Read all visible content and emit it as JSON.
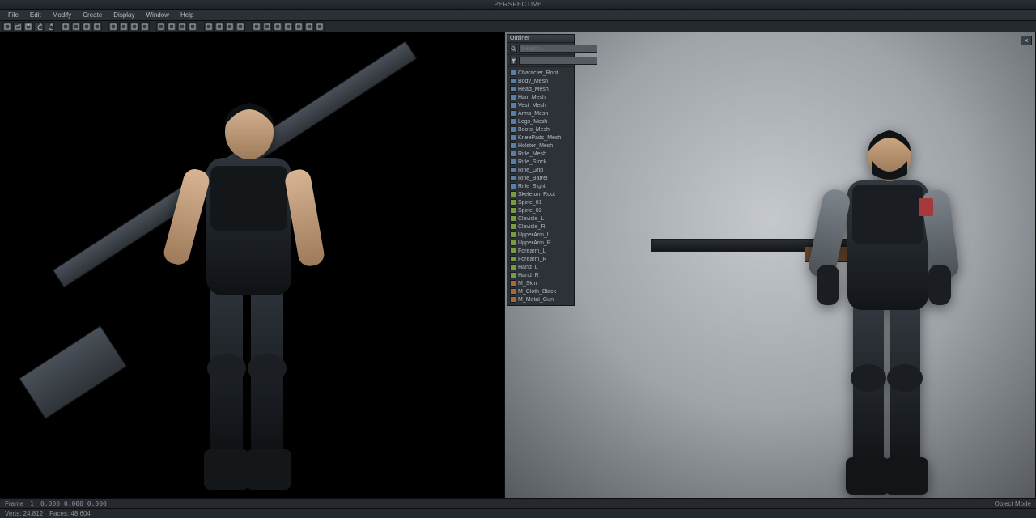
{
  "titlebar": {
    "left": "",
    "center": "PERSPECTIVE",
    "right": ""
  },
  "menubar": {
    "items": [
      "File",
      "Edit",
      "Modify",
      "Create",
      "Display",
      "Window",
      "Help"
    ]
  },
  "shelf": {
    "tools": [
      "new-icon",
      "open-icon",
      "save-icon",
      "undo-icon",
      "redo-icon",
      "select-icon",
      "move-icon",
      "rotate-icon",
      "scale-icon",
      "mesh-icon",
      "surface-icon",
      "curve-icon",
      "lattice-icon",
      "joint-icon",
      "ik-icon",
      "skin-icon",
      "paint-icon",
      "render-icon",
      "light-icon",
      "camera-icon",
      "grid-icon",
      "snap-icon",
      "wire-icon",
      "shade-icon",
      "smooth-icon",
      "uv-icon",
      "tex-icon",
      "graph-icon"
    ]
  },
  "panel": {
    "title": "Outliner",
    "search_placeholder": "Search...",
    "search_value": "",
    "items": [
      {
        "type": "mesh",
        "label": "Character_Root"
      },
      {
        "type": "mesh",
        "label": "Body_Mesh"
      },
      {
        "type": "mesh",
        "label": "Head_Mesh"
      },
      {
        "type": "mesh",
        "label": "Hair_Mesh"
      },
      {
        "type": "mesh",
        "label": "Vest_Mesh"
      },
      {
        "type": "mesh",
        "label": "Arms_Mesh"
      },
      {
        "type": "mesh",
        "label": "Legs_Mesh"
      },
      {
        "type": "mesh",
        "label": "Boots_Mesh"
      },
      {
        "type": "mesh",
        "label": "KneePads_Mesh"
      },
      {
        "type": "mesh",
        "label": "Holster_Mesh"
      },
      {
        "type": "mesh",
        "label": "Rifle_Mesh"
      },
      {
        "type": "mesh",
        "label": "Rifle_Stock"
      },
      {
        "type": "mesh",
        "label": "Rifle_Grip"
      },
      {
        "type": "mesh",
        "label": "Rifle_Barrel"
      },
      {
        "type": "mesh",
        "label": "Rifle_Sight"
      },
      {
        "type": "bone",
        "label": "Skeleton_Root"
      },
      {
        "type": "bone",
        "label": "Spine_01"
      },
      {
        "type": "bone",
        "label": "Spine_02"
      },
      {
        "type": "bone",
        "label": "Clavicle_L"
      },
      {
        "type": "bone",
        "label": "Clavicle_R"
      },
      {
        "type": "bone",
        "label": "UpperArm_L"
      },
      {
        "type": "bone",
        "label": "UpperArm_R"
      },
      {
        "type": "bone",
        "label": "Forearm_L"
      },
      {
        "type": "bone",
        "label": "Forearm_R"
      },
      {
        "type": "bone",
        "label": "Hand_L"
      },
      {
        "type": "bone",
        "label": "Hand_R"
      },
      {
        "type": "mat",
        "label": "M_Skin"
      },
      {
        "type": "mat",
        "label": "M_Cloth_Black"
      },
      {
        "type": "mat",
        "label": "M_Metal_Gun"
      }
    ]
  },
  "status": {
    "frame_label": "Frame",
    "frame": "1",
    "coords": "0.000  0.000  0.000",
    "mode": "Object Mode",
    "verts": "Verts: 24,812",
    "faces": "Faces: 48,604"
  },
  "viewport_right_close": "×"
}
